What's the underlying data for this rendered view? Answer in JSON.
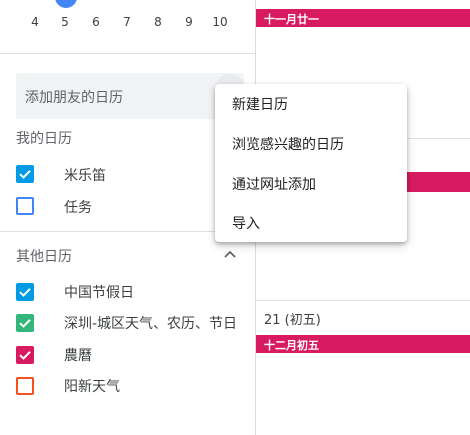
{
  "mini_calendar": {
    "days": [
      "4",
      "5",
      "6",
      "7",
      "8",
      "9",
      "10"
    ]
  },
  "add_friend": {
    "placeholder": "添加朋友的日历"
  },
  "my_calendars": {
    "title": "我的日历",
    "items": [
      {
        "label": "米乐笛",
        "checked": true,
        "color": "#039be5"
      },
      {
        "label": "任务",
        "checked": false,
        "color": "#4285f4"
      }
    ]
  },
  "other_calendars": {
    "title": "其他日历",
    "items": [
      {
        "label": "中国节假日",
        "checked": true,
        "color": "#039be5"
      },
      {
        "label": "深圳-城区天气、农历、节日",
        "checked": true,
        "color": "#33b679"
      },
      {
        "label": "農曆",
        "checked": true,
        "color": "#d81b60"
      },
      {
        "label": "阳新天气",
        "checked": false,
        "color": "#f4511e"
      }
    ]
  },
  "main": {
    "event_top": "十一月廿一",
    "event_bottom": "十二月初五",
    "date_label": "21 (初五)"
  },
  "menu": {
    "items": [
      "新建日历",
      "浏览感兴趣的日历",
      "通过网址添加",
      "导入"
    ]
  },
  "colors": {
    "accent": "#4285f4",
    "event": "#d81b60"
  }
}
